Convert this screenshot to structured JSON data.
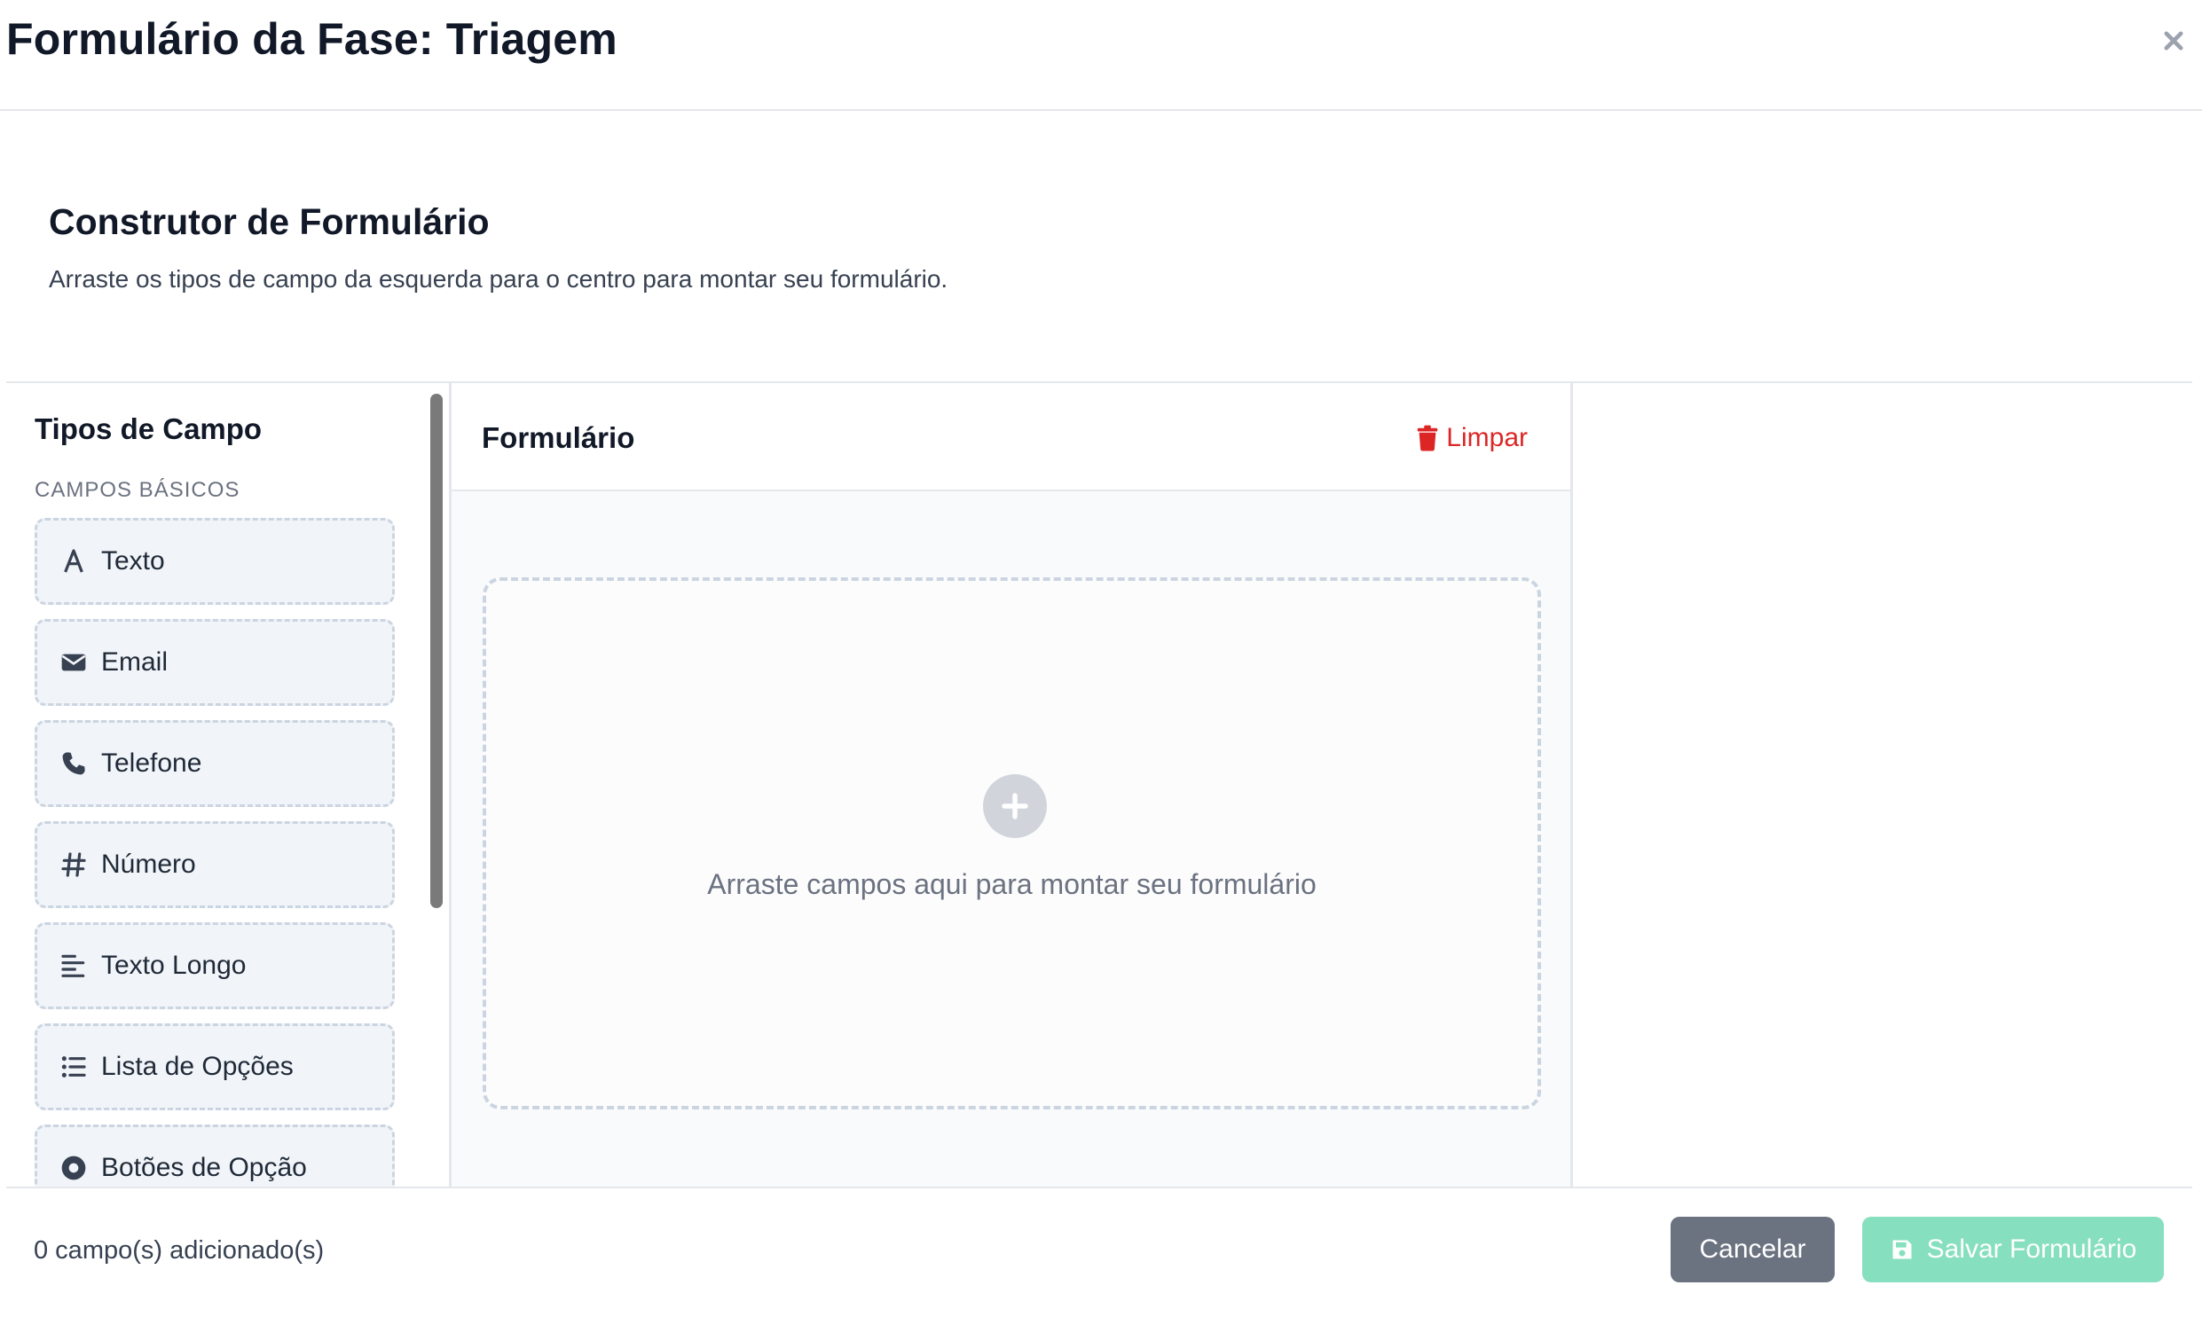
{
  "modal": {
    "title": "Formulário da Fase: Triagem",
    "close_icon": "close-icon"
  },
  "intro": {
    "title": "Construtor de Formulário",
    "description": "Arraste os tipos de campo da esquerda para o centro para montar seu formulário."
  },
  "sidebar": {
    "title": "Tipos de Campo",
    "section_label": "CAMPOS BÁSICOS",
    "items": [
      {
        "label": "Texto",
        "icon": "text-icon"
      },
      {
        "label": "Email",
        "icon": "envelope-icon"
      },
      {
        "label": "Telefone",
        "icon": "phone-icon"
      },
      {
        "label": "Número",
        "icon": "hash-icon"
      },
      {
        "label": "Texto Longo",
        "icon": "align-left-icon"
      },
      {
        "label": "Lista de Opções",
        "icon": "list-icon"
      },
      {
        "label": "Botões de Opção",
        "icon": "radio-icon"
      }
    ]
  },
  "canvas": {
    "title": "Formulário",
    "clear_label": "Limpar",
    "clear_icon": "trash-icon",
    "dropzone_text": "Arraste campos aqui para montar seu formulário",
    "dropzone_icon": "plus-icon"
  },
  "footer": {
    "count_text": "0 campo(s) adicionado(s)",
    "cancel_label": "Cancelar",
    "save_label": "Salvar Formulário",
    "save_icon": "save-icon"
  },
  "colors": {
    "danger": "#dc2626",
    "cancel_bg": "#6b7280",
    "save_bg": "#86dfbe"
  }
}
